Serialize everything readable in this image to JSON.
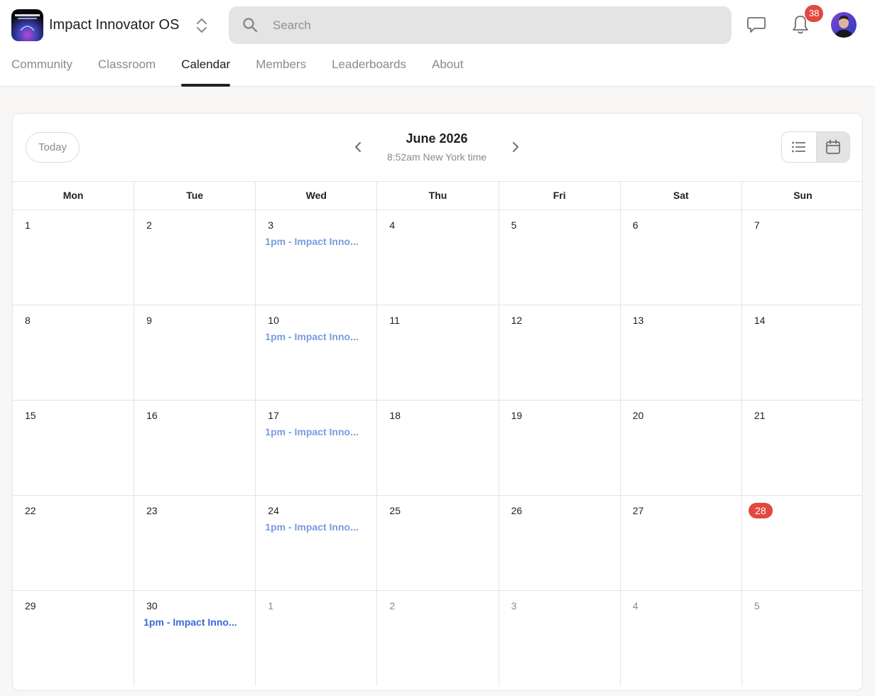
{
  "header": {
    "app_title": "Impact Innovator OS",
    "logo_icon": "community-logo",
    "search_placeholder": "Search",
    "notification_count": "38",
    "badge_color": "#e2483e"
  },
  "tabs": [
    {
      "label": "Community",
      "active": false
    },
    {
      "label": "Classroom",
      "active": false
    },
    {
      "label": "Calendar",
      "active": true
    },
    {
      "label": "Members",
      "active": false
    },
    {
      "label": "Leaderboards",
      "active": false
    },
    {
      "label": "About",
      "active": false
    }
  ],
  "calendar": {
    "today_label": "Today",
    "month_title": "June 2026",
    "timezone_text": "8:52am New York time",
    "view": "month",
    "weekdays": [
      "Mon",
      "Tue",
      "Wed",
      "Thu",
      "Fri",
      "Sat",
      "Sun"
    ],
    "event_color": "#7a9be0",
    "today_color": "#e2483e",
    "weeks": [
      [
        {
          "n": "1"
        },
        {
          "n": "2"
        },
        {
          "n": "3",
          "event": "1pm - Impact Inno..."
        },
        {
          "n": "4"
        },
        {
          "n": "5"
        },
        {
          "n": "6"
        },
        {
          "n": "7"
        }
      ],
      [
        {
          "n": "8"
        },
        {
          "n": "9"
        },
        {
          "n": "10",
          "event": "1pm - Impact Inno..."
        },
        {
          "n": "11"
        },
        {
          "n": "12"
        },
        {
          "n": "13"
        },
        {
          "n": "14"
        }
      ],
      [
        {
          "n": "15"
        },
        {
          "n": "16"
        },
        {
          "n": "17",
          "event": "1pm - Impact Inno..."
        },
        {
          "n": "18"
        },
        {
          "n": "19"
        },
        {
          "n": "20"
        },
        {
          "n": "21"
        }
      ],
      [
        {
          "n": "22"
        },
        {
          "n": "23"
        },
        {
          "n": "24",
          "event": "1pm - Impact Inno..."
        },
        {
          "n": "25"
        },
        {
          "n": "26"
        },
        {
          "n": "27"
        },
        {
          "n": "28",
          "today": true
        }
      ],
      [
        {
          "n": "29"
        },
        {
          "n": "30",
          "event": "1pm - Impact Inno...",
          "strong": true
        },
        {
          "n": "1",
          "other": true
        },
        {
          "n": "2",
          "other": true
        },
        {
          "n": "3",
          "other": true
        },
        {
          "n": "4",
          "other": true
        },
        {
          "n": "5",
          "other": true
        }
      ]
    ]
  }
}
